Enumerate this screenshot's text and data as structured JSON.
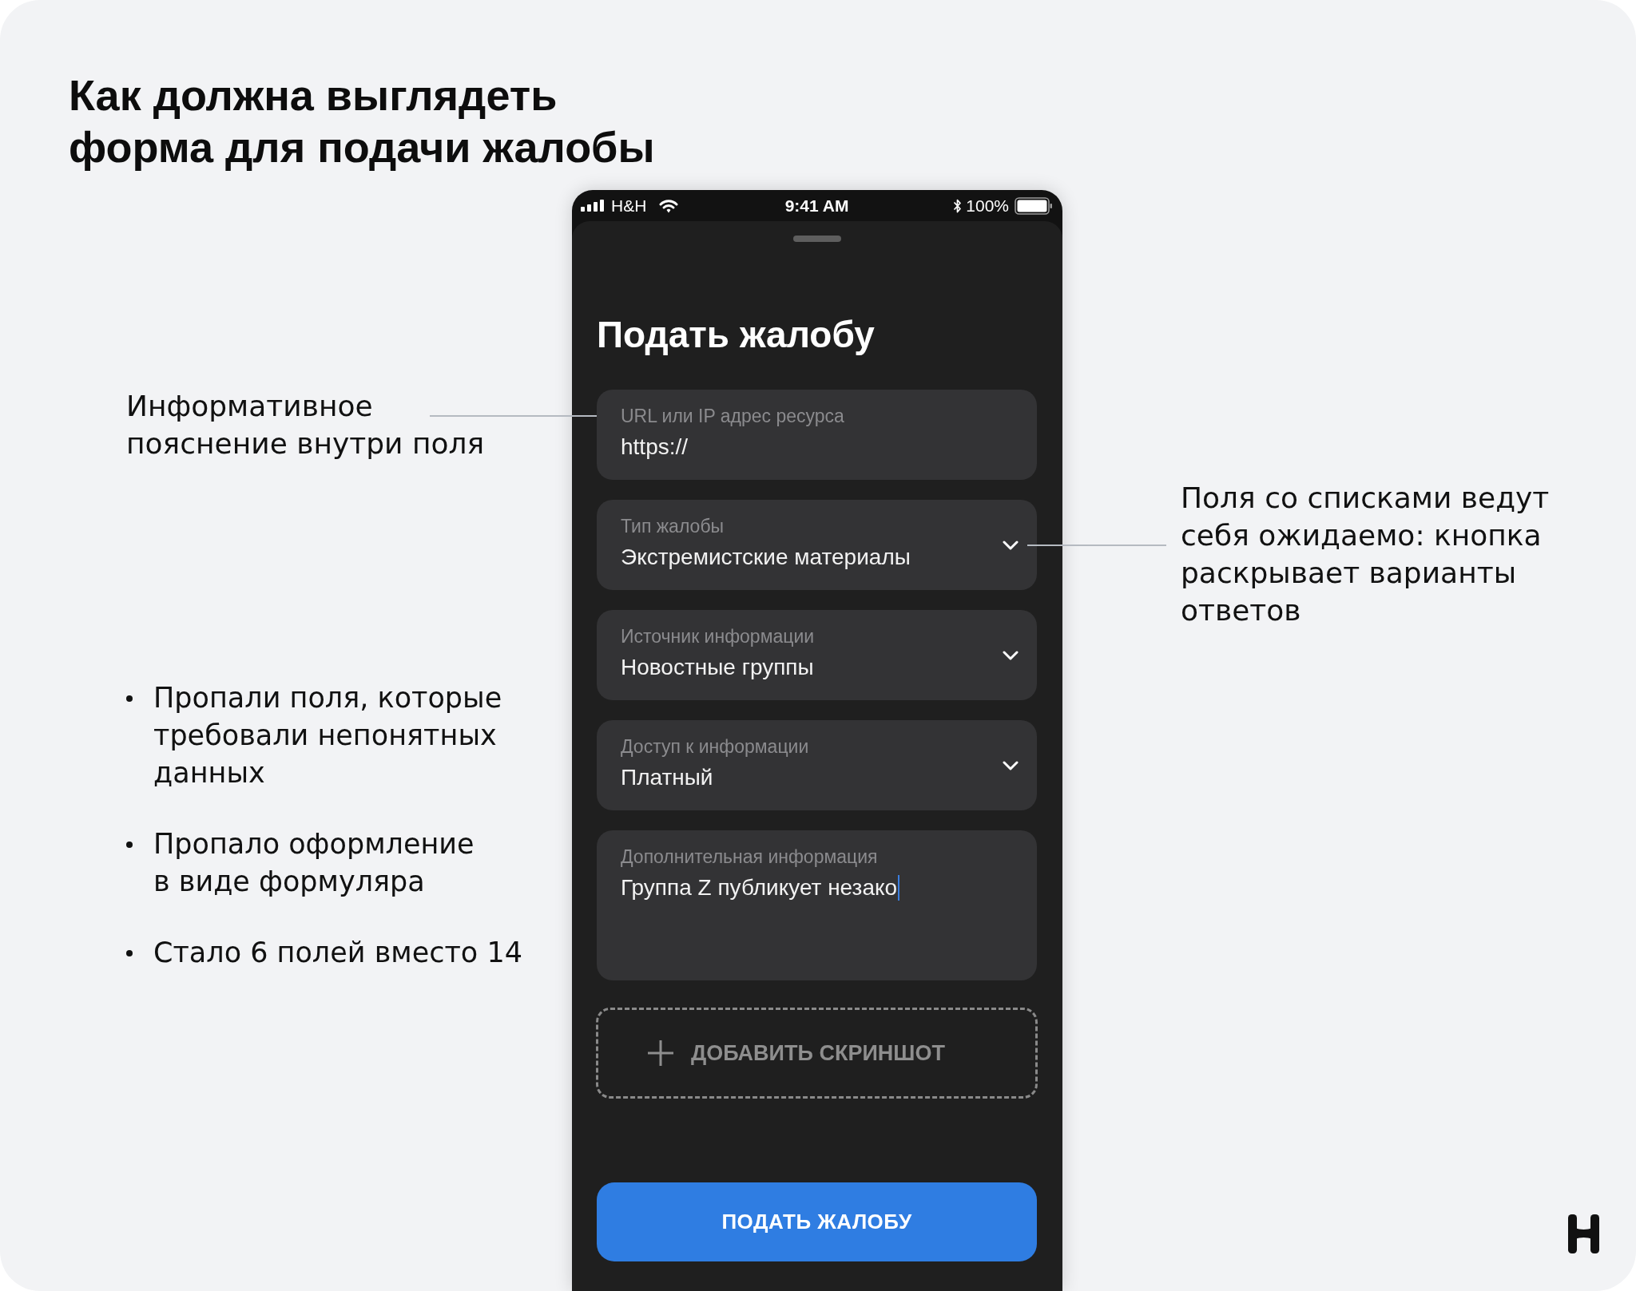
{
  "slide": {
    "title": "Как должна выглядеть\nформа для подачи жалобы"
  },
  "left_note": "Информативное\nпояснение внутри поля",
  "right_note": "Поля со списками ведут\nсебя ожидаемо: кнопка\nраскрывает варианты\nответов",
  "bullets": [
    "Пропали поля, которые\nтребовали непонятных\nданных",
    "Пропало оформление\nв виде формуляра",
    "Стало 6 полей вместо 14"
  ],
  "phone": {
    "status_bar": {
      "carrier": "H&H",
      "time": "9:41 AM",
      "battery": "100%"
    },
    "title": "Подать жалобу",
    "fields": [
      {
        "kind": "text",
        "label": "URL или IP адрес ресурса",
        "value": "https://",
        "focused": false
      },
      {
        "kind": "select",
        "label": "Тип жалобы",
        "value": "Экстремистские материалы",
        "focused": false
      },
      {
        "kind": "select",
        "label": "Источник информации",
        "value": "Новостные группы",
        "focused": false
      },
      {
        "kind": "select",
        "label": "Доступ к информации",
        "value": "Платный",
        "focused": false
      },
      {
        "kind": "textarea",
        "label": "Дополнительная информация",
        "value": "Группа Z публикует незако",
        "focused": true
      }
    ],
    "upload_button": "ДОБАВИТЬ СКРИНШОТ",
    "submit_button": "ПОДАТЬ ЖАЛОБУ"
  }
}
